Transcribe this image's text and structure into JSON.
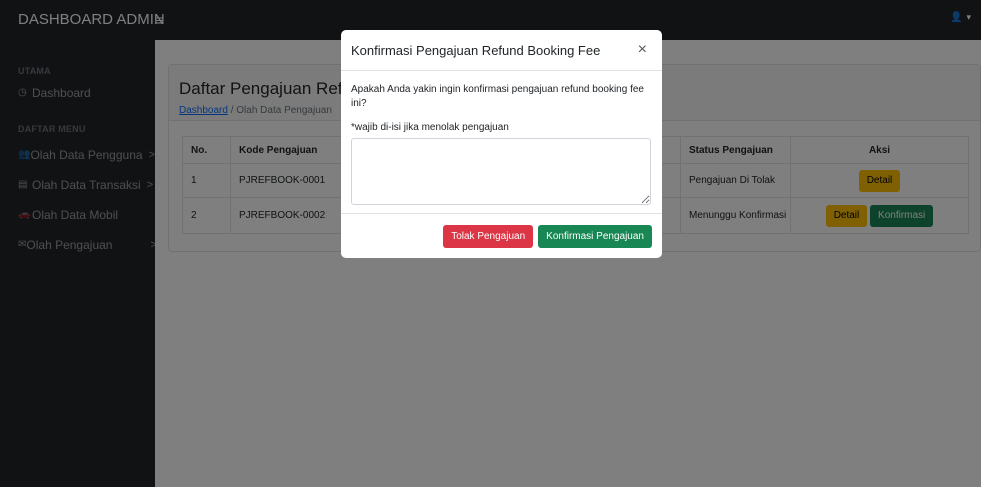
{
  "navbar": {
    "brand": "DASHBOARD ADMIN",
    "toggle_icon": "≡",
    "user_icon": "👤",
    "caret": "▾"
  },
  "sidebar": {
    "heading_main": "UTAMA",
    "dashboard": {
      "icon": "◷",
      "label": "Dashboard"
    },
    "heading_menu": "DAFTAR MENU",
    "items": [
      {
        "icon": "👥",
        "label": "Olah Data Pengguna",
        "chevron": ">"
      },
      {
        "icon": "▤",
        "label": "Olah Data Transaksi",
        "chevron": ">"
      },
      {
        "icon": "🚗",
        "label": "Olah Data Mobil",
        "chevron": ""
      },
      {
        "icon": "✉",
        "label": "Olah Pengajuan",
        "chevron": ">"
      }
    ]
  },
  "page": {
    "title": "Daftar Pengajuan Refund Booking Fee",
    "breadcrumb_link": "Dashboard",
    "breadcrumb_sep": "/",
    "breadcrumb_current": "Olah Data Pengajuan"
  },
  "table": {
    "headers": {
      "no": "No.",
      "kode": "Kode Pengajuan",
      "status": "Status Pengajuan",
      "aksi": "Aksi"
    },
    "rows": [
      {
        "no": "1",
        "kode": "PJREFBOOK-0001",
        "status": "Pengajuan Di Tolak",
        "detail": "Detail",
        "konfirmasi": ""
      },
      {
        "no": "2",
        "kode": "PJREFBOOK-0002",
        "status": "Menunggu Konfirmasi",
        "detail": "Detail",
        "konfirmasi": "Konfirmasi"
      }
    ]
  },
  "modal": {
    "title": "Konfirmasi Pengajuan Refund Booking Fee",
    "close": "×",
    "question": "Apakah Anda yakin ingin konfirmasi pengajuan refund booking fee ini?",
    "note": "*wajib di-isi jika menolak pengajuan",
    "reason_value": "",
    "reject_button": "Tolak Pengajuan",
    "confirm_button": "Konfirmasi Pengajuan"
  }
}
